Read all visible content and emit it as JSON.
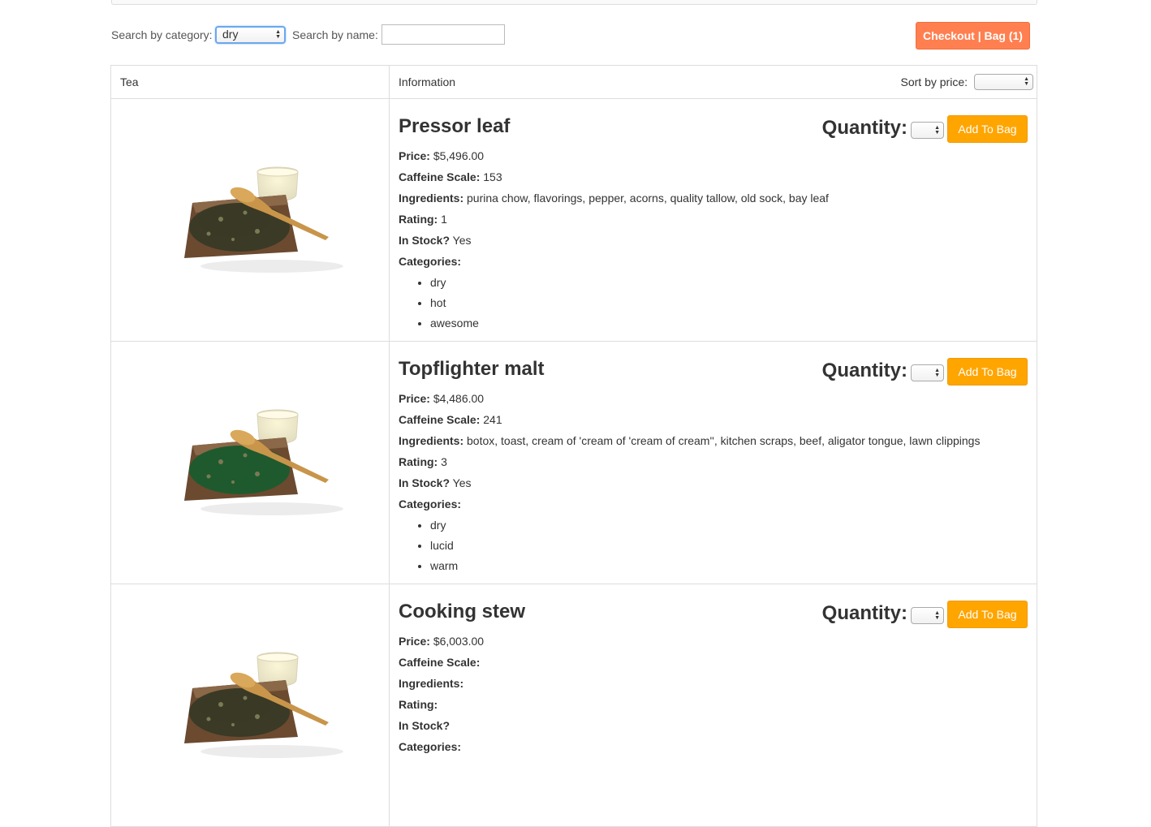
{
  "controls": {
    "category_label": "Search by category:",
    "category_value": "dry",
    "name_label": "Search by name:",
    "name_value": "",
    "checkout_label": "Checkout | Bag (1)"
  },
  "table": {
    "col_tea": "Tea",
    "col_info": "Information",
    "sort_label": "Sort by price:",
    "sort_value": ""
  },
  "labels": {
    "quantity": "Quantity:",
    "add_to_bag": "Add To Bag",
    "price": "Price:",
    "caffeine": "Caffeine Scale:",
    "ingredients": "Ingredients:",
    "rating": "Rating:",
    "in_stock": "In Stock?",
    "categories": "Categories:"
  },
  "teas": [
    {
      "name": "Pressor leaf",
      "price": "$5,496.00",
      "caffeine": "153",
      "ingredients": "purina chow, flavorings, pepper, acorns, quality tallow, old sock, bay leaf",
      "rating": "1",
      "in_stock": "Yes",
      "categories": [
        "dry",
        "hot",
        "awesome"
      ],
      "leaf_color": "#3a3a26"
    },
    {
      "name": "Topflighter malt",
      "price": "$4,486.00",
      "caffeine": "241",
      "ingredients": "botox, toast, cream of 'cream of 'cream of cream'', kitchen scraps, beef, aligator tongue, lawn clippings",
      "rating": "3",
      "in_stock": "Yes",
      "categories": [
        "dry",
        "lucid",
        "warm"
      ],
      "leaf_color": "#1f5a2e"
    },
    {
      "name": "Cooking stew",
      "price": "$6,003.00",
      "caffeine": "",
      "ingredients": "",
      "rating": "",
      "in_stock": "",
      "categories": [],
      "leaf_color": "#3a3a26"
    }
  ]
}
